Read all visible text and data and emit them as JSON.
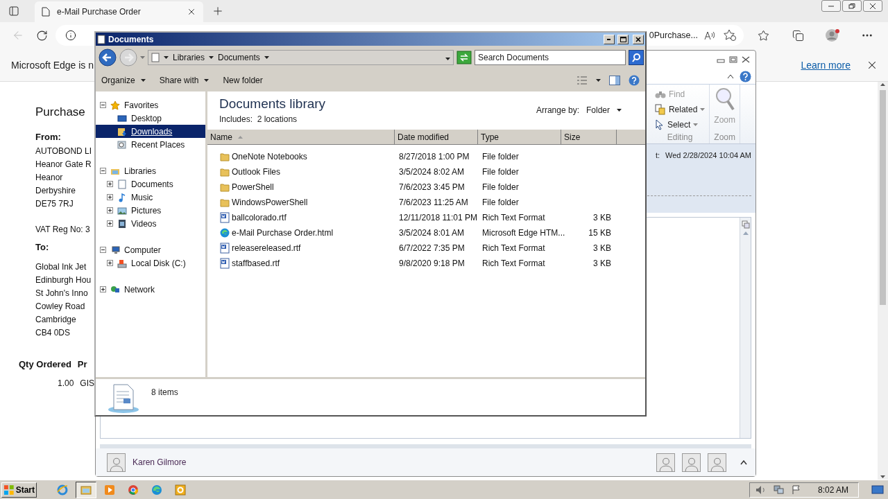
{
  "browser": {
    "tab": {
      "title": "e-Mail Purchase Order"
    },
    "back_button": {
      "disabled": true
    },
    "address": {
      "value": "0Purchase..."
    },
    "infobar": {
      "message": "Microsoft Edge is n",
      "link": "Learn more"
    }
  },
  "page": {
    "title": "Purchase",
    "from_label": "From:",
    "from_lines": [
      "AUTOBOND LI",
      "Heanor Gate R",
      "Heanor",
      "Derbyshire",
      "DE75 7RJ"
    ],
    "vat": "VAT Reg No: 3",
    "to_label": "To:",
    "to_lines": [
      "Global Ink Jet",
      "Edinburgh Hou",
      "St John's Inno",
      "Cowley Road",
      "Cambridge",
      "CB4 0DS"
    ],
    "table_headers": [
      "Qty Ordered",
      "Pr"
    ],
    "table_cells": [
      "1.00",
      "GIS"
    ]
  },
  "outlook": {
    "ribbon_groups": [
      {
        "label": "Editing",
        "items": [
          {
            "label": "Find",
            "kind": "find",
            "disabled": true,
            "dropdown": false
          },
          {
            "label": "Related",
            "kind": "related",
            "disabled": false,
            "dropdown": true
          },
          {
            "label": "Select",
            "kind": "select",
            "disabled": false,
            "dropdown": true
          }
        ]
      },
      {
        "label": "Zoom",
        "items": [
          {
            "label": "Zoom",
            "kind": "zoom",
            "disabled": true,
            "dropdown": false
          }
        ]
      }
    ],
    "sent": {
      "label": "t:",
      "value": "Wed 2/28/2024 10:04 AM"
    },
    "contact": "Karen Gilmore"
  },
  "explorer": {
    "title": "Documents",
    "breadcrumb": [
      "Libraries",
      "Documents"
    ],
    "search": {
      "placeholder": "Search Documents"
    },
    "commands": [
      {
        "label": "Organize",
        "dropdown": true
      },
      {
        "label": "Share with",
        "dropdown": true
      },
      {
        "label": "New folder",
        "dropdown": false
      }
    ],
    "nav": [
      {
        "label": "Favorites",
        "kind": "star",
        "expanded": true,
        "selected": false,
        "children": [
          {
            "label": "Desktop",
            "kind": "desktop",
            "selected": false
          },
          {
            "label": "Downloads",
            "kind": "downloads",
            "selected": true
          },
          {
            "label": "Recent Places",
            "kind": "recent",
            "selected": false
          }
        ]
      },
      {
        "label": "Libraries",
        "kind": "library",
        "expanded": true,
        "selected": false,
        "children": [
          {
            "label": "Documents",
            "kind": "documents",
            "expanded": false,
            "selected": false
          },
          {
            "label": "Music",
            "kind": "music",
            "expanded": false,
            "selected": false
          },
          {
            "label": "Pictures",
            "kind": "pictures",
            "expanded": false,
            "selected": false
          },
          {
            "label": "Videos",
            "kind": "videos",
            "expanded": false,
            "selected": false
          }
        ]
      },
      {
        "label": "Computer",
        "kind": "computer",
        "expanded": true,
        "selected": false,
        "children": [
          {
            "label": "Local Disk (C:)",
            "kind": "disk",
            "expanded": false,
            "selected": false
          }
        ]
      },
      {
        "label": "Network",
        "kind": "network",
        "expanded": false,
        "selected": false
      }
    ],
    "library_title": "Documents library",
    "includes": "Includes:  2 locations",
    "arrange_label": "Arrange by:",
    "arrange_value": "Folder",
    "columns": [
      {
        "label": "Name",
        "sorted": true
      },
      {
        "label": "Date modified",
        "sorted": false
      },
      {
        "label": "Type",
        "sorted": false
      },
      {
        "label": "Size",
        "sorted": false
      }
    ],
    "files": [
      {
        "name": "OneNote Notebooks",
        "date": "8/27/2018 1:00 PM",
        "type": "File folder",
        "kind": "folder"
      },
      {
        "name": "Outlook Files",
        "date": "3/5/2024 8:02 AM",
        "type": "File folder",
        "kind": "folder"
      },
      {
        "name": "PowerShell",
        "date": "7/6/2023 3:45 PM",
        "type": "File folder",
        "kind": "folder"
      },
      {
        "name": "WindowsPowerShell",
        "date": "7/6/2023 11:25 AM",
        "type": "File folder",
        "kind": "folder"
      },
      {
        "name": "ballcolorado.rtf",
        "date": "12/11/2018 11:01 PM",
        "type": "Rich Text Format",
        "size": "3 KB",
        "kind": "rtf"
      },
      {
        "name": "e-Mail Purchase Order.html",
        "date": "3/5/2024 8:01 AM",
        "type": "Microsoft Edge HTM...",
        "size": "15 KB",
        "kind": "edge"
      },
      {
        "name": "releasereleased.rtf",
        "date": "6/7/2022 7:35 PM",
        "type": "Rich Text Format",
        "size": "3 KB",
        "kind": "rtf"
      },
      {
        "name": "staffbased.rtf",
        "date": "9/8/2020 9:18 PM",
        "type": "Rich Text Format",
        "size": "3 KB",
        "kind": "rtf"
      }
    ],
    "status": "8 items"
  },
  "taskbar": {
    "start": "Start",
    "apps": [
      {
        "kind": "ie",
        "selected": false
      },
      {
        "kind": "explorer",
        "selected": true
      },
      {
        "kind": "media",
        "selected": false
      },
      {
        "kind": "chrome",
        "selected": false
      },
      {
        "kind": "edge",
        "selected": false
      },
      {
        "kind": "outlook",
        "selected": false
      }
    ],
    "clock": "8:02 AM"
  }
}
